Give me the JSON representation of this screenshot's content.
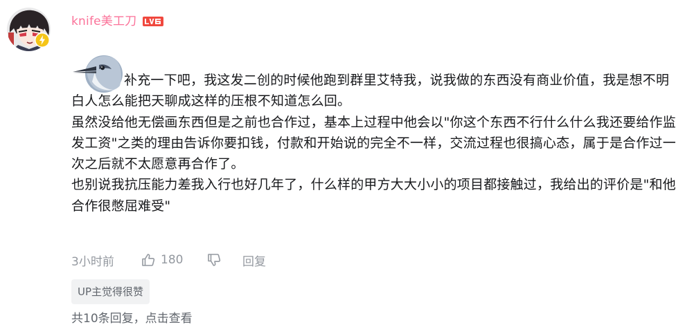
{
  "comment": {
    "username": "knife美工刀",
    "level": "LV6",
    "paragraphs": [
      "补充一下吧，我这发二创的时候他跑到群里艾特我，说我做的东西没有商业价值，我是想不明白人怎么能把天聊成这样的压根不知道怎么回。",
      "虽然没给他无偿画东西但是之前也合作过，基本上过程中他会以\"你这个东西不行什么什么我还要给作监发工资\"之类的理由告诉你要扣钱，付款和开始说的完全不一样，交流过程也很搞心态，属于是合作过一次之后就不太愿意再合作了。",
      "也别说我抗压能力差我入行也好几年了，什么样的甲方大大小小的项目都接触过，我给出的评价是\"和他合作很憋屈难受\""
    ],
    "time": "3小时前",
    "likes": "180",
    "reply_label": "回复",
    "up_tag": "UP主觉得很赞",
    "reply_summary": "共10条回复，点击查看"
  },
  "colors": {
    "username": "#fb7299",
    "level_badge": "#f0483e",
    "meta_text": "#9499a0",
    "body_text": "#18191c",
    "tag_bg": "#f1f2f3",
    "bolt_badge": "#f5c518"
  },
  "icons": {
    "avatar": "anime-avatar",
    "bolt": "lightning-bolt-icon",
    "like": "thumbs-up-icon",
    "dislike": "thumbs-down-icon",
    "sticker": "bird-sticker"
  }
}
